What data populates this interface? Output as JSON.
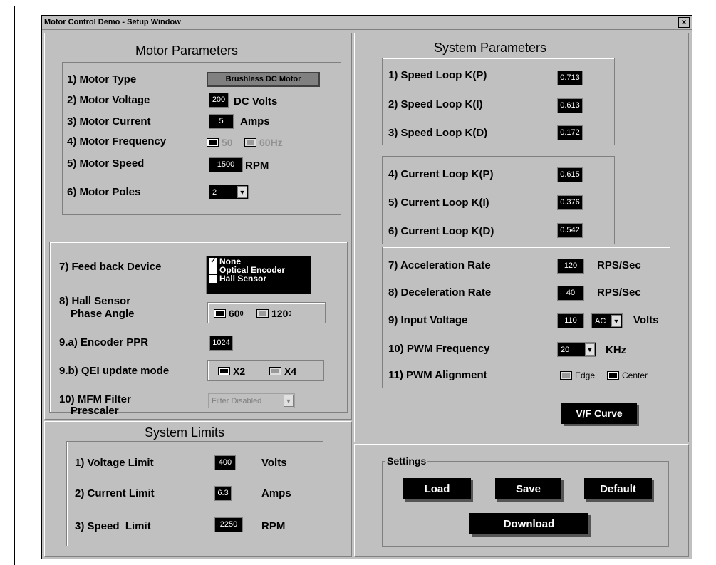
{
  "window": {
    "title": "Motor Control Demo - Setup Window",
    "close_glyph": "×"
  },
  "motor_parameters": {
    "heading": "Motor Parameters",
    "motor_type": {
      "label": "1) Motor Type",
      "value": "Brushless DC Motor"
    },
    "motor_voltage": {
      "label": "2) Motor Voltage",
      "value": "200",
      "unit": "DC Volts"
    },
    "motor_current": {
      "label": "3) Motor Current",
      "value": "5",
      "unit": "Amps"
    },
    "motor_frequency": {
      "label": "4) Motor Frequency",
      "opt1": "50",
      "opt2": "60Hz"
    },
    "motor_speed": {
      "label": "5) Motor Speed",
      "value": "1500",
      "unit": "RPM"
    },
    "motor_poles": {
      "label": "6) Motor Poles",
      "value": "2"
    }
  },
  "feedback": {
    "feedback_device": {
      "label": "7) Feed back Device",
      "options": [
        {
          "label": "None",
          "checked": true
        },
        {
          "label": "Optical Encoder",
          "checked": false
        },
        {
          "label": "Hall Sensor",
          "checked": false
        }
      ]
    },
    "hall_phase": {
      "label_line1": "8) Hall Sensor",
      "label_line2": "Phase Angle",
      "opt1": "60",
      "opt2": "120",
      "degree": "0"
    },
    "encoder_ppr": {
      "label": "9.a) Encoder PPR",
      "value": "1024"
    },
    "qei_mode": {
      "label": "9.b) QEI update mode",
      "opt1": "X2",
      "opt2": "X4"
    },
    "mfm_filter": {
      "label_line1": "10) MFM Filter",
      "label_line2": "Prescaler",
      "value": "Filter Disabled"
    }
  },
  "system_limits": {
    "heading": "System Limits",
    "voltage_limit": {
      "label": "1) Voltage Limit",
      "value": "400",
      "unit": "Volts"
    },
    "current_limit": {
      "label": "2) Current Limit",
      "value": "6.3",
      "unit": "Amps"
    },
    "speed_limit": {
      "label": "3) Speed  Limit",
      "value": "2250",
      "unit": "RPM"
    }
  },
  "system_parameters": {
    "heading": "System Parameters",
    "speed_kp": {
      "label": "1) Speed Loop K(P)",
      "value": "0.713"
    },
    "speed_ki": {
      "label": "2) Speed Loop K(I)",
      "value": "0.613"
    },
    "speed_kd": {
      "label": "3) Speed Loop K(D)",
      "value": "0.172"
    },
    "current_kp": {
      "label": "4) Current Loop K(P)",
      "value": "0.615"
    },
    "current_ki": {
      "label": "5) Current Loop K(I)",
      "value": "0.376"
    },
    "current_kd": {
      "label": "6) Current Loop K(D)",
      "value": "0.542"
    },
    "accel_rate": {
      "label": "7) Acceleration Rate",
      "value": "120",
      "unit": "RPS/Sec"
    },
    "decel_rate": {
      "label": "8) Deceleration Rate",
      "value": "40",
      "unit": "RPS/Sec"
    },
    "input_voltage": {
      "label": "9) Input Voltage",
      "value": "110",
      "type": "AC",
      "unit": "Volts"
    },
    "pwm_frequency": {
      "label": "10) PWM Frequency",
      "value": "20",
      "unit": "KHz"
    },
    "pwm_alignment": {
      "label": "11) PWM Alignment",
      "opt1": "Edge",
      "opt2": "Center"
    },
    "vf_curve_button": "V/F Curve"
  },
  "settings": {
    "legend": "Settings",
    "load": "Load",
    "save": "Save",
    "default": "Default",
    "download": "Download"
  }
}
